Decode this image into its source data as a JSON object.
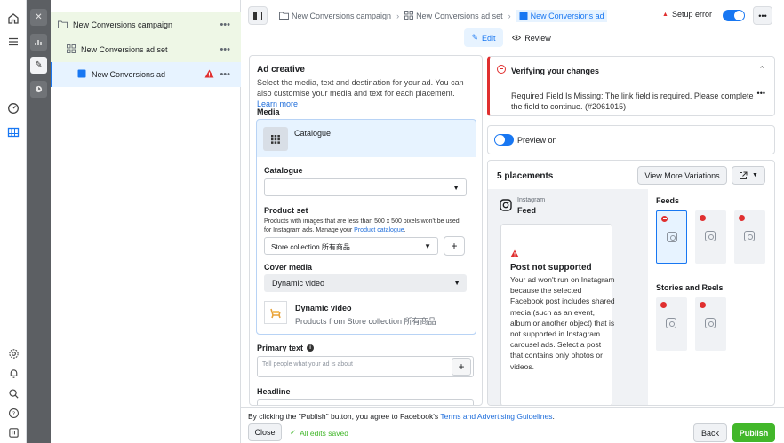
{
  "tree": {
    "campaign": "New Conversions campaign",
    "adset": "New Conversions ad set",
    "ad": "New Conversions ad"
  },
  "topbar": {
    "crumb_campaign": "New Conversions campaign",
    "crumb_adset": "New Conversions ad set",
    "crumb_ad": "New Conversions ad",
    "setup_error": "Setup error",
    "edit": "Edit",
    "review": "Review"
  },
  "ad_creative": {
    "title": "Ad creative",
    "description": "Select the media, text and destination for your ad. You can also customise your media and text for each placement.",
    "learn_more": "Learn more",
    "media_label": "Media",
    "media_option": "Catalogue",
    "catalogue_label": "Catalogue",
    "catalogue_value": "",
    "product_set_label": "Product set",
    "product_set_help": "Products with images that are less than 500 x 500 pixels won't be used for Instagram ads. Manage your",
    "product_catalogue_link": "Product catalogue",
    "product_set_value": "Store collection 所有商品",
    "cover_media_label": "Cover media",
    "cover_media_value": "Dynamic video",
    "dynamic_title": "Dynamic video",
    "dynamic_sub": "Products from Store collection 所有商品",
    "primary_text_label": "Primary text",
    "primary_text_placeholder": "Tell people what your ad is about",
    "headline_label": "Headline"
  },
  "verify": {
    "title": "Verifying your changes",
    "message": "Required Field Is Missing: The link field is required. Please complete the field to continue. (#2061015)"
  },
  "preview": {
    "toggle_label": "Preview on",
    "placements": "5 placements",
    "view_more": "View More Variations",
    "ig_name": "Instagram",
    "ig_feed": "Feed",
    "not_supported_title": "Post not supported",
    "not_supported_body": "Your ad won't run on Instagram because the selected Facebook post includes shared media (such as an event, album or another object) that is not supported in Instagram carousel ads. Select a post that contains only photos or videos.",
    "feeds": "Feeds",
    "stories": "Stories and Reels"
  },
  "footer": {
    "agree_text": "By clicking the \"Publish\" button, you agree to Facebook's",
    "terms_link": "Terms and Advertising Guidelines",
    "close": "Close",
    "saved": "All edits saved",
    "back": "Back",
    "publish": "Publish"
  },
  "colors": {
    "accent": "#1877f2",
    "publish_green": "#42b72a",
    "error_red": "#e02f2f",
    "tree_highlight": "#eef7e6"
  }
}
